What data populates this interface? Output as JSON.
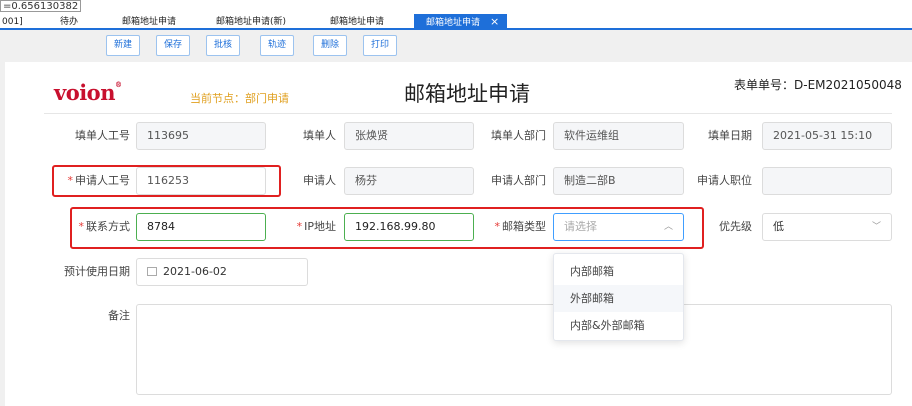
{
  "coord_readout": "=0.656130382",
  "tabs": [
    {
      "label": "001]"
    },
    {
      "label": "待办"
    },
    {
      "label": "邮箱地址申请"
    },
    {
      "label": "邮箱地址申请(新)"
    },
    {
      "label": "邮箱地址申请"
    },
    {
      "label": "邮箱地址申请",
      "active": true,
      "close": "×"
    }
  ],
  "toolbar": {
    "new": "新建",
    "save": "保存",
    "approve": "批核",
    "track": "轨迹",
    "delete": "删除",
    "print": "打印"
  },
  "header": {
    "logo_text": "voion",
    "logo_mark": "®",
    "current_node": "当前节点：部门申请",
    "title": "邮箱地址申请",
    "form_number": "表单单号：D-EM2021050048"
  },
  "form": {
    "filler_id_label": "填单人工号",
    "filler_id": "113695",
    "filler_label": "填单人",
    "filler": "张焕贤",
    "filler_dept_label": "填单人部门",
    "filler_dept": "软件运维组",
    "fill_date_label": "填单日期",
    "fill_date": "2021-05-31 15:10",
    "req_mark": "*",
    "applicant_id_label": "申请人工号",
    "applicant_id": "116253",
    "applicant_label": "申请人",
    "applicant": "杨芬",
    "applicant_dept_label": "申请人部门",
    "applicant_dept": "制造二部B",
    "applicant_title_label": "申请人职位",
    "applicant_title": "",
    "contact_label": "联系方式",
    "contact": "8784",
    "ip_label": "IP地址",
    "ip": "192.168.99.80",
    "mailbox_type_label": "邮箱类型",
    "mailbox_type_placeholder": "请选择",
    "priority_label": "优先级",
    "priority": "低",
    "expected_date_label": "预计使用日期",
    "expected_date": "2021-06-02",
    "remark_label": "备注",
    "remark": ""
  },
  "dropdown": {
    "options": [
      "内部邮箱",
      "外部邮箱",
      "内部&外部邮箱"
    ],
    "hovered_index": 1
  },
  "colors": {
    "accent": "#1e6fd9",
    "required": "#e53935",
    "highlight_box": "#e02020",
    "valid_border": "#4caf50",
    "focus_border": "#409eff",
    "logo": "#c8102e",
    "node_text": "#e0a020"
  }
}
